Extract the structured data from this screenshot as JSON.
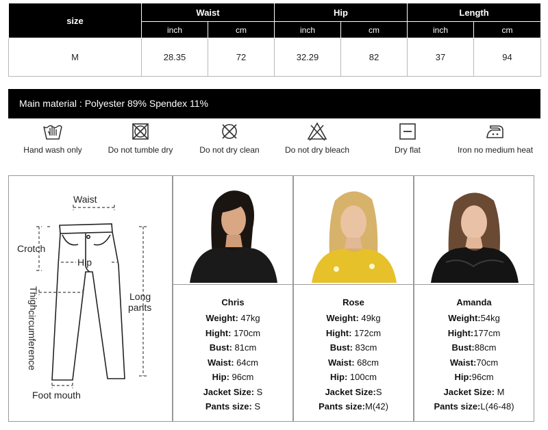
{
  "size_table": {
    "size_header": "size",
    "groups": [
      {
        "label": "Waist",
        "units": [
          "inch",
          "cm"
        ],
        "values": [
          "28.35",
          "72"
        ]
      },
      {
        "label": "Hip",
        "units": [
          "inch",
          "cm"
        ],
        "values": [
          "32.29",
          "82"
        ]
      },
      {
        "label": "Length",
        "units": [
          "inch",
          "cm"
        ],
        "values": [
          "37",
          "94"
        ]
      }
    ],
    "size_value": "M"
  },
  "material": "Main material : Polyester 89% Spendex 11%",
  "care": [
    {
      "icon": "hand-wash-icon",
      "label": "Hand wash only"
    },
    {
      "icon": "no-tumble-dry-icon",
      "label": "Do not tumble dry"
    },
    {
      "icon": "no-dry-clean-icon",
      "label": "Do not dry clean"
    },
    {
      "icon": "no-bleach-icon",
      "label": "Do not dry bleach"
    },
    {
      "icon": "dry-flat-icon",
      "label": "Dry flat"
    },
    {
      "icon": "iron-medium-icon",
      "label": "Iron no medium heat"
    }
  ],
  "measure_labels": {
    "waist": "Waist",
    "crotch": "Crotch",
    "hip": "Hip",
    "thigh_1": "Thigh",
    "thigh_2": "circumference",
    "long_1": "Long",
    "long_2": "pants",
    "foot": "Foot mouth"
  },
  "models": [
    {
      "name": "Chris",
      "lines": [
        {
          "k": "Weight:",
          "v": " 47kg"
        },
        {
          "k": "Hight:",
          "v": " 170cm"
        },
        {
          "k": "Bust:",
          "v": " 81cm"
        },
        {
          "k": "Waist:",
          "v": " 64cm"
        },
        {
          "k": "Hip:",
          "v": " 96cm"
        },
        {
          "k": "Jacket Size:",
          "v": " S"
        },
        {
          "k": "Pants size:",
          "v": " S"
        }
      ]
    },
    {
      "name": "Rose",
      "lines": [
        {
          "k": "Weight:",
          "v": " 49kg"
        },
        {
          "k": "Hight:",
          "v": " 172cm"
        },
        {
          "k": "Bust:",
          "v": " 83cm"
        },
        {
          "k": "Waist:",
          "v": " 68cm"
        },
        {
          "k": "Hip:",
          "v": " 100cm"
        },
        {
          "k": "Jacket Size:",
          "v": "S"
        },
        {
          "k": "Pants size:",
          "v": "M(42)"
        }
      ]
    },
    {
      "name": "Amanda",
      "lines": [
        {
          "k": "Weight:",
          "v": "54kg"
        },
        {
          "k": "Hight:",
          "v": "177cm"
        },
        {
          "k": "Bust:",
          "v": "88cm"
        },
        {
          "k": "Waist:",
          "v": "70cm"
        },
        {
          "k": "Hip:",
          "v": "96cm"
        },
        {
          "k": "Jacket Size:",
          "v": " M"
        },
        {
          "k": "Pants size:",
          "v": "L(46-48)"
        }
      ]
    }
  ]
}
